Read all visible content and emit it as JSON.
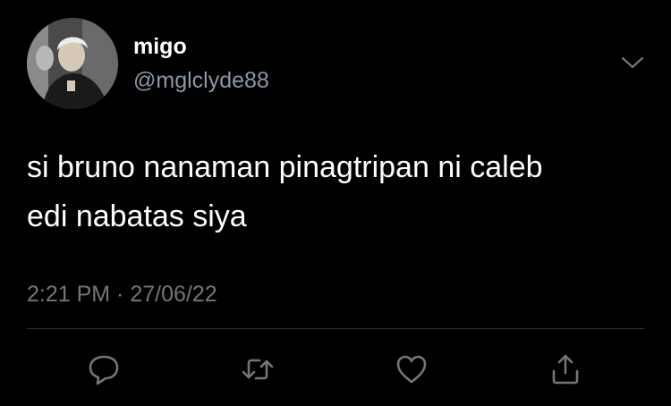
{
  "user": {
    "display_name": "migo",
    "handle": "@mglclyde88",
    "avatar_icon": "profile-photo"
  },
  "menu": {
    "icon": "chevron-down-icon"
  },
  "tweet": {
    "line1": "si bruno nanaman pinagtripan ni caleb",
    "line2": "edi nabatas siya"
  },
  "meta": {
    "timestamp": "2:21 PM · 27/06/22"
  },
  "actions": [
    {
      "icon": "reply-icon"
    },
    {
      "icon": "retweet-icon"
    },
    {
      "icon": "like-icon"
    },
    {
      "icon": "share-icon"
    }
  ],
  "colors": {
    "background": "#000000",
    "text_primary": "#ffffff",
    "text_secondary": "#71767b",
    "divider": "#2f3336"
  }
}
